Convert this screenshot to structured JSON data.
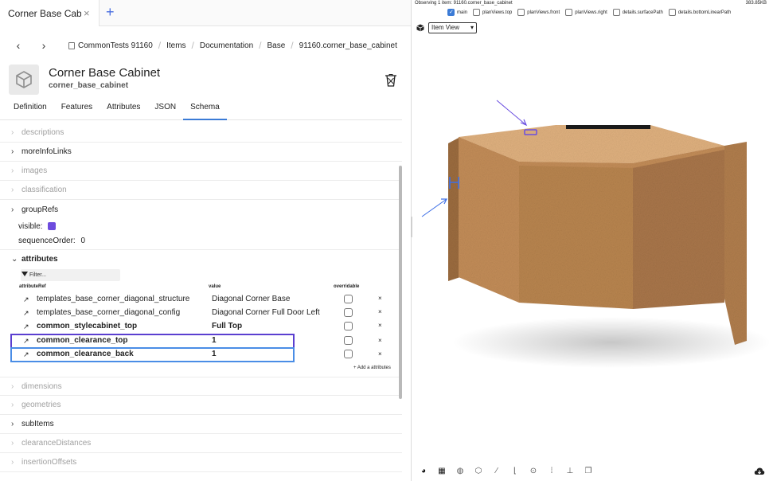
{
  "tabbar": {
    "active_tab": "Corner Base Cab...",
    "close": "×",
    "add": "+"
  },
  "nav": {
    "back": "‹",
    "forward": "›",
    "breadcrumbs": [
      "CommonTests 91160",
      "Items",
      "Documentation",
      "Base",
      "91160.corner_base_cabinet"
    ]
  },
  "item": {
    "title": "Corner Base Cabinet",
    "subtitle": "corner_base_cabinet"
  },
  "tabs": [
    "Definition",
    "Features",
    "Attributes",
    "JSON",
    "Schema"
  ],
  "active_tab_index": 4,
  "sections": {
    "descriptions": "descriptions",
    "moreInfoLinks": "moreInfoLinks",
    "images": "images",
    "classification": "classification",
    "groupRefs": "groupRefs",
    "attributes": "attributes",
    "dimensions": "dimensions",
    "geometries": "geometries",
    "subItems": "subItems",
    "clearanceDistances": "clearanceDistances",
    "insertionOffsets": "insertionOffsets"
  },
  "props": {
    "visible_label": "visible:",
    "visible_color": "#6d4cde",
    "sequence_label": "sequenceOrder:",
    "sequence_value": "0"
  },
  "attributes_table": {
    "filter_placeholder": "Filter...",
    "headers": {
      "ref": "attributeRef",
      "value": "value",
      "overridable": "overridable"
    },
    "rows": [
      {
        "ref": "templates_base_corner_diagonal_structure",
        "value": "Diagonal Corner Base",
        "overridable": false
      },
      {
        "ref": "templates_base_corner_diagonal_config",
        "value": "Diagonal Corner Full Door Left",
        "overridable": false
      },
      {
        "ref": "common_stylecabinet_top",
        "value": "Full Top",
        "overridable": false
      },
      {
        "ref": "common_clearance_top",
        "value": "1",
        "overridable": false
      },
      {
        "ref": "common_clearance_back",
        "value": "1",
        "overridable": false
      }
    ],
    "remove_label": "×",
    "add_label": "+ Add a attributes"
  },
  "viewer": {
    "observing": "Observing 1 item: 91160.corner_base_cabinet",
    "size": "383.85KB",
    "view_checks": [
      {
        "label": "main",
        "checked": true
      },
      {
        "label": "planViews.top",
        "checked": false
      },
      {
        "label": "planViews.front",
        "checked": false
      },
      {
        "label": "planViews.right",
        "checked": false
      },
      {
        "label": "details.surfacePath",
        "checked": false
      },
      {
        "label": "details.bottomLinearPath",
        "checked": false
      }
    ],
    "view_mode": "Item View",
    "colors": {
      "wood_top": "#e0b17f",
      "wood_side_light": "#c9965f",
      "wood_side_dark": "#b27f4d",
      "marker_purple": "#6a4ee0",
      "marker_blue": "#3d6fe6"
    }
  },
  "bottom_tools": [
    "palette-icon",
    "grid-icon",
    "compass-icon",
    "cube-icon",
    "brush-icon",
    "bracket-icon",
    "target-icon",
    "dots-icon",
    "hierarchy-icon",
    "layers-icon"
  ]
}
